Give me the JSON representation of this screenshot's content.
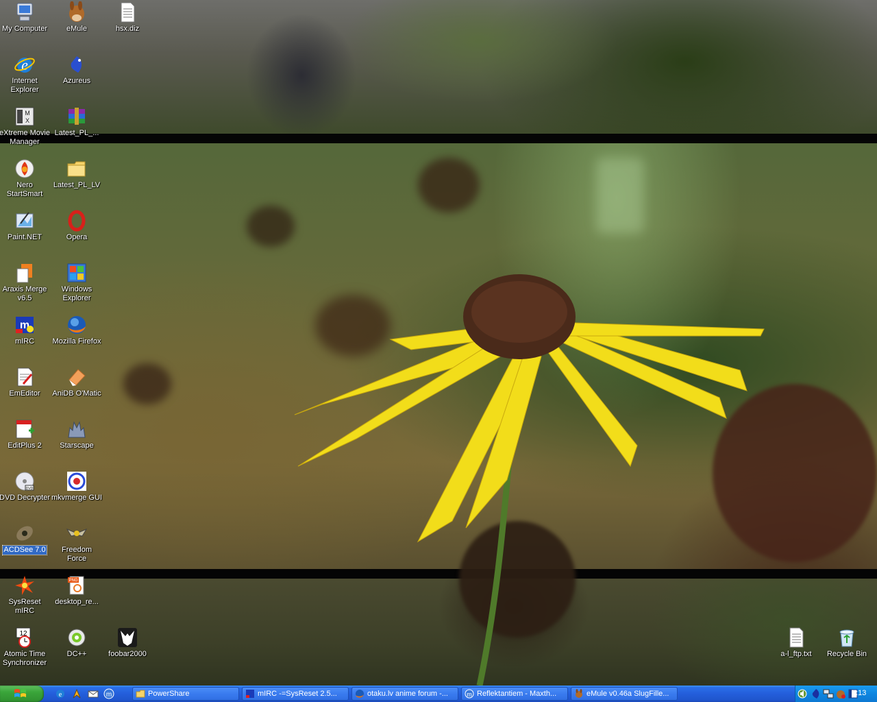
{
  "desktop": {
    "icons": [
      {
        "label": "My Computer",
        "icon": "computer-icon"
      },
      {
        "label": "eMule",
        "icon": "emule-mule-icon"
      },
      {
        "label": "hsx.diz",
        "icon": "text-file-icon"
      },
      {
        "label": "Internet Explorer",
        "icon": "internet-explorer-icon"
      },
      {
        "label": "Azureus",
        "icon": "azureus-frog-icon"
      },
      {
        "label": "eXtreme Movie Manager",
        "icon": "movie-manager-icon"
      },
      {
        "label": "Latest_PL_...",
        "icon": "winrar-archive-icon"
      },
      {
        "label": "Nero StartSmart",
        "icon": "nero-icon"
      },
      {
        "label": "Latest_PL_LV",
        "icon": "folder-icon"
      },
      {
        "label": "Paint.NET",
        "icon": "paint-net-icon"
      },
      {
        "label": "Opera",
        "icon": "opera-icon"
      },
      {
        "label": "Araxis Merge v6.5",
        "icon": "araxis-merge-icon"
      },
      {
        "label": "Windows Explorer",
        "icon": "windows-explorer-icon"
      },
      {
        "label": "mIRC",
        "icon": "mirc-icon"
      },
      {
        "label": "Mozilla Firefox",
        "icon": "firefox-icon"
      },
      {
        "label": "EmEditor",
        "icon": "emeditor-icon"
      },
      {
        "label": "AniDB O'Matic",
        "icon": "anidb-omatic-icon"
      },
      {
        "label": "EditPlus 2",
        "icon": "editplus-icon"
      },
      {
        "label": "Starscape",
        "icon": "starscape-icon"
      },
      {
        "label": "DVD Decrypter",
        "icon": "dvd-disc-icon"
      },
      {
        "label": "mkvmerge GUI",
        "icon": "mkvmerge-icon"
      },
      {
        "label": "ACDSee 7.0",
        "icon": "acdsee-icon"
      },
      {
        "label": "Freedom Force",
        "icon": "freedom-force-icon"
      },
      {
        "label": "SysReset mIRC",
        "icon": "sysreset-burst-icon"
      },
      {
        "label": "desktop_re...",
        "icon": "png-image-icon"
      },
      {
        "label": "Atomic Time Synchronizer",
        "icon": "atomic-clock-icon"
      },
      {
        "label": "DC++",
        "icon": "dcplusplus-icon"
      },
      {
        "label": "foobar2000",
        "icon": "foobar-icon"
      },
      {
        "label": "a-l_ftp.txt",
        "icon": "text-file-icon"
      },
      {
        "label": "Recycle Bin",
        "icon": "recycle-bin-icon"
      }
    ]
  },
  "taskbar": {
    "quick_launch": [
      "internet-explorer-icon",
      "winamp-icon",
      "outlook-express-icon",
      "maxthon-icon"
    ],
    "tasks": [
      {
        "label": "PowerShare",
        "icon": "folder-icon"
      },
      {
        "label": "mIRC -=SysReset 2.5...",
        "icon": "mirc-icon"
      },
      {
        "label": "otaku.lv anime forum -...",
        "icon": "firefox-icon"
      },
      {
        "label": "Reflektantiem - Maxth...",
        "icon": "maxthon-icon"
      },
      {
        "label": "eMule v0.46a SlugFille...",
        "icon": "emule-mule-icon"
      }
    ],
    "tray_icons": [
      "speaker-icon",
      "azureus-tray-icon",
      "network-icon",
      "emule-tray-icon",
      "window-icon"
    ],
    "clock": "0:13"
  },
  "colors": {
    "taskbar_blue": "#245edb",
    "start_green": "#3aa53a",
    "tray_blue": "#0f86e0",
    "selection_blue": "#316ac5",
    "flower_yellow": "#f2dd1a"
  }
}
